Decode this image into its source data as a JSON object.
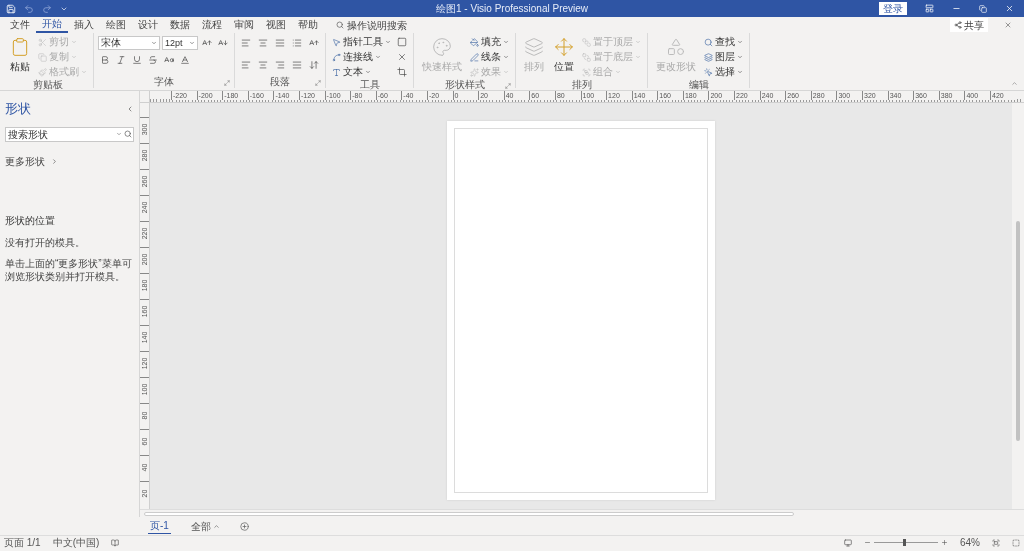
{
  "title_bar": {
    "title": "绘图1 - Visio Professional Preview",
    "sign_in": "登录"
  },
  "menu_tabs": [
    {
      "label": "文件",
      "selected": false
    },
    {
      "label": "开始",
      "selected": true
    },
    {
      "label": "插入",
      "selected": false
    },
    {
      "label": "绘图",
      "selected": false
    },
    {
      "label": "设计",
      "selected": false
    },
    {
      "label": "数据",
      "selected": false
    },
    {
      "label": "流程",
      "selected": false
    },
    {
      "label": "审阅",
      "selected": false
    },
    {
      "label": "视图",
      "selected": false
    },
    {
      "label": "帮助",
      "selected": false
    }
  ],
  "tell_me": {
    "placeholder": "操作说明搜索"
  },
  "share": "共享",
  "ribbon": {
    "groups": [
      {
        "label": "剪贴板",
        "launcher": false,
        "items": [
          {
            "kind": "large",
            "label": "粘贴",
            "disabled": false
          },
          {
            "kind": "small",
            "label": "剪切",
            "disabled": true
          },
          {
            "kind": "small",
            "label": "复制",
            "disabled": true
          },
          {
            "kind": "small",
            "label": "格式刷",
            "disabled": true
          }
        ]
      },
      {
        "label": "字体",
        "launcher": true,
        "items": [
          {
            "kind": "font",
            "font": "宋体",
            "size": "12pt"
          }
        ]
      },
      {
        "label": "段落",
        "launcher": true,
        "items": [
          {
            "kind": "paragraph"
          }
        ]
      },
      {
        "label": "工具",
        "launcher": false,
        "items": [
          {
            "kind": "small",
            "label": "指针工具",
            "disabled": false
          },
          {
            "kind": "small",
            "label": "连接线",
            "disabled": false
          },
          {
            "kind": "small",
            "label": "文本",
            "disabled": false
          },
          {
            "kind": "tools"
          }
        ]
      },
      {
        "label": "形状样式",
        "launcher": true,
        "items": [
          {
            "kind": "large",
            "label": "快速样式",
            "disabled": true
          },
          {
            "kind": "small",
            "label": "填充",
            "disabled": false
          },
          {
            "kind": "small",
            "label": "线条",
            "disabled": false
          },
          {
            "kind": "small",
            "label": "效果",
            "disabled": true
          }
        ]
      },
      {
        "label": "排列",
        "launcher": false,
        "items": [
          {
            "kind": "large",
            "label": "排列",
            "disabled": true
          },
          {
            "kind": "large",
            "label": "位置",
            "disabled": false
          },
          {
            "kind": "small",
            "label": "置于顶层",
            "disabled": true
          },
          {
            "kind": "small",
            "label": "置于底层",
            "disabled": true
          },
          {
            "kind": "small",
            "label": "组合",
            "disabled": true
          }
        ]
      },
      {
        "label": "编辑",
        "launcher": false,
        "items": [
          {
            "kind": "large",
            "label": "更改形状",
            "disabled": true
          },
          {
            "kind": "small",
            "label": "查找",
            "disabled": false
          },
          {
            "kind": "small",
            "label": "图层",
            "disabled": false
          },
          {
            "kind": "small",
            "label": "选择",
            "disabled": false
          }
        ]
      }
    ]
  },
  "shapes_pane": {
    "title": "形状",
    "search": {
      "placeholder": "搜索形状"
    },
    "more_shapes": "更多形状",
    "section_title": "形状的位置",
    "messages": [
      "没有打开的模具。",
      "单击上面的“更多形状”菜单可浏览形状类别并打开模具。"
    ]
  },
  "rulers": {
    "horizontal": [
      "-220",
      "-200",
      "-180",
      "-160",
      "-140",
      "-120",
      "-100",
      "-80",
      "-60",
      "-40",
      "-20",
      "0",
      "20",
      "40",
      "60",
      "80",
      "100",
      "120",
      "140",
      "160",
      "180",
      "200",
      "220",
      "240",
      "260",
      "280",
      "300",
      "320",
      "340",
      "360",
      "380",
      "400",
      "420"
    ],
    "vertical": [
      "300",
      "280",
      "260",
      "240",
      "220",
      "200",
      "180",
      "160",
      "140",
      "120",
      "100",
      "80",
      "60",
      "40",
      "20"
    ]
  },
  "page_tabs": [
    {
      "label": "页-1",
      "selected": true
    }
  ],
  "all_pages": "全部",
  "status_bar": {
    "page": "页面 1/1",
    "language": "中文(中国)",
    "zoom": {
      "level": 0.45,
      "reading": "64%"
    }
  }
}
